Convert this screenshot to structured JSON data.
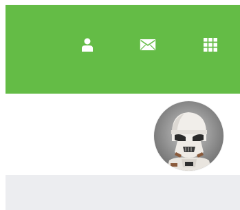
{
  "header": {
    "background_color": "#64bc46",
    "icons": [
      {
        "name": "user-icon",
        "color": "#ffffff"
      },
      {
        "name": "mail-icon",
        "color": "#ffffff"
      },
      {
        "name": "grid-icon",
        "color": "#ffffff"
      }
    ]
  },
  "profile": {
    "avatar_subject": "stormtrooper-figure-photo"
  },
  "footer": {
    "background_color": "#ecedf0"
  }
}
